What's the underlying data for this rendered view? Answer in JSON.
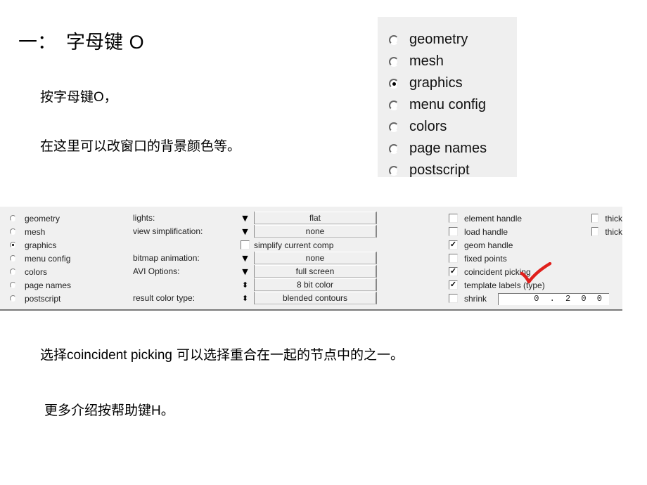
{
  "slide": {
    "heading_number": "一：",
    "heading_text": "字母键 ",
    "heading_key": "O",
    "para1_cn": "按字母键",
    "para1_key": "O",
    "para1_tail": "，",
    "para2": "在这里可以改窗口的背景颜色等。",
    "para3_cn1": "选择",
    "para3_lat": "coincident picking",
    "para3_cn2": " 可以选择重合在一起的节点中的之一。",
    "para4_cn": "更多介绍按帮助键",
    "para4_key": "H",
    "para4_tail": "。"
  },
  "radio_box": {
    "options": [
      {
        "label": "geometry",
        "selected": false
      },
      {
        "label": "mesh",
        "selected": false
      },
      {
        "label": "graphics",
        "selected": true
      },
      {
        "label": "menu config",
        "selected": false
      },
      {
        "label": "colors",
        "selected": false
      },
      {
        "label": "page names",
        "selected": false
      },
      {
        "label": "postscript",
        "selected": false
      }
    ]
  },
  "panel": {
    "radios": [
      {
        "label": "geometry",
        "selected": false
      },
      {
        "label": "mesh",
        "selected": false
      },
      {
        "label": "graphics",
        "selected": true
      },
      {
        "label": "menu config",
        "selected": false
      },
      {
        "label": "colors",
        "selected": false
      },
      {
        "label": "page names",
        "selected": false
      },
      {
        "label": "postscript",
        "selected": false
      }
    ],
    "labels": {
      "lights": "lights:",
      "view_simplification": "view simplification:",
      "bitmap_animation": "bitmap animation:",
      "avi_options": "AVI Options:",
      "result_color_type": "result color type:"
    },
    "dropdowns": {
      "lights": {
        "arrow": "▼",
        "value": "flat"
      },
      "view_simplification": {
        "arrow": "▼",
        "value": "none"
      },
      "bitmap_animation": {
        "arrow": "▼",
        "value": "none"
      },
      "avi_options": {
        "arrow": "▼",
        "value": "full screen"
      },
      "color_depth": {
        "arrow": "⬍",
        "value": "8 bit color"
      },
      "result_color_type": {
        "arrow": "⬍",
        "value": "blended contours"
      }
    },
    "simplify_current_comp": {
      "label": "simplify current comp",
      "checked": false
    },
    "checkboxes": [
      {
        "label": "element handle",
        "checked": false
      },
      {
        "label": "load handle",
        "checked": false
      },
      {
        "label": "geom handle",
        "checked": true
      },
      {
        "label": "fixed points",
        "checked": false
      },
      {
        "label": "coincident picking",
        "checked": true
      },
      {
        "label": "template labels (type)",
        "checked": true
      },
      {
        "label": "shrink",
        "checked": false
      }
    ],
    "shrink_value": "0.200",
    "right_checkboxes": [
      {
        "label": "thick",
        "checked": false
      },
      {
        "label": "thick",
        "checked": false
      }
    ],
    "check_mark": "✓"
  },
  "annotation": {
    "color": "#e0201c"
  }
}
